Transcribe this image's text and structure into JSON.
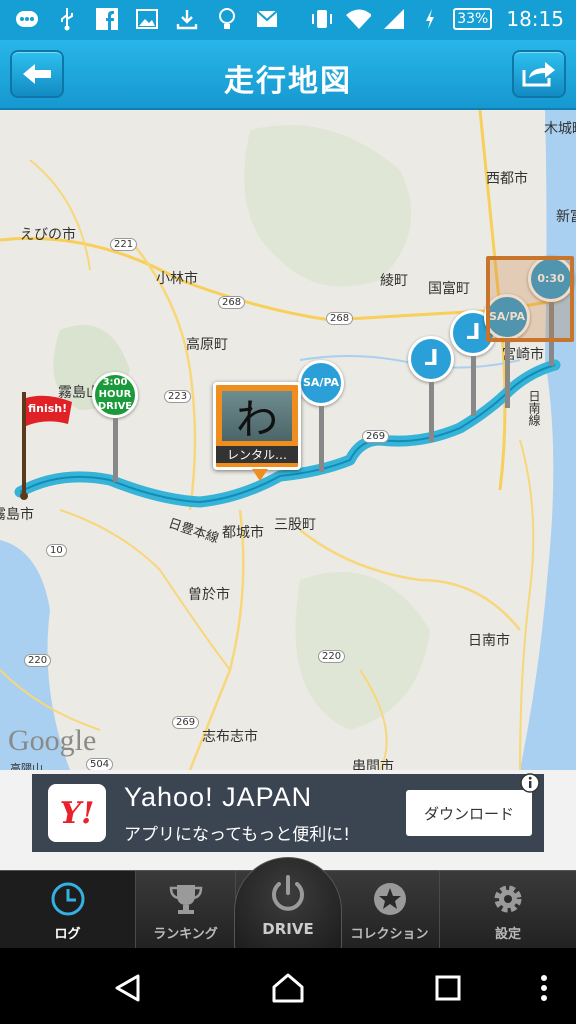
{
  "status_bar": {
    "battery": "33%",
    "time": "18:15",
    "icons": [
      "chat-icon",
      "usb-icon",
      "facebook-icon",
      "image-icon",
      "download-icon",
      "bulb-icon",
      "mail-icon",
      "vibrate-icon",
      "wifi-icon",
      "signal-icon",
      "charging-icon"
    ]
  },
  "header": {
    "title": "走行地図",
    "back_icon": "back-arrow-icon",
    "share_icon": "share-icon"
  },
  "map": {
    "labels": [
      {
        "id": "ebino",
        "text": "えびの市"
      },
      {
        "id": "kobayashi",
        "text": "小林市"
      },
      {
        "id": "takaharu",
        "text": "高原町"
      },
      {
        "id": "kirishimayama",
        "text": "霧島山"
      },
      {
        "id": "aya",
        "text": "綾町"
      },
      {
        "id": "kunitomi",
        "text": "国富町"
      },
      {
        "id": "saito",
        "text": "西都市"
      },
      {
        "id": "kijo",
        "text": "木城町"
      },
      {
        "id": "shintomi",
        "text": "新富"
      },
      {
        "id": "miyazaki",
        "text": "宮崎市"
      },
      {
        "id": "nichinan_line",
        "text": "日南線"
      },
      {
        "id": "miyakonojo",
        "text": "都城市"
      },
      {
        "id": "mimata",
        "text": "三股町"
      },
      {
        "id": "nippo_line",
        "text": "日豊本線"
      },
      {
        "id": "soo",
        "text": "曽於市"
      },
      {
        "id": "nichinan",
        "text": "日南市"
      },
      {
        "id": "shibushi",
        "text": "志布志市"
      },
      {
        "id": "kushima",
        "text": "串間市"
      },
      {
        "id": "kirishima",
        "text": "霧島市"
      },
      {
        "id": "takakuma",
        "text": "高隈山"
      },
      {
        "id": "r221",
        "text": "221"
      },
      {
        "id": "r268a",
        "text": "268"
      },
      {
        "id": "r268b",
        "text": "268"
      },
      {
        "id": "r223",
        "text": "223"
      },
      {
        "id": "r269a",
        "text": "269"
      },
      {
        "id": "r269b",
        "text": "269"
      },
      {
        "id": "r10",
        "text": "10"
      },
      {
        "id": "r220a",
        "text": "220"
      },
      {
        "id": "r220b",
        "text": "220"
      },
      {
        "id": "r504",
        "text": "504"
      }
    ],
    "google_logo": "Google",
    "finish_flag": "finish!",
    "rental_caption": "レンタル…",
    "rental_char": "わ",
    "pins": [
      {
        "id": "time-3h",
        "text": "3:00\nHOUR DRIVE",
        "color": "#1a9a3a"
      },
      {
        "id": "sapa-1",
        "text": "SA/PA",
        "color": "#2a9fd8"
      },
      {
        "id": "junction-1",
        "text": "⅃",
        "color": "#2a9fd8"
      },
      {
        "id": "junction-2",
        "text": "⅃",
        "color": "#2a9fd8"
      },
      {
        "id": "sapa-2",
        "text": "SA/PA",
        "color": "#2a9fd8"
      },
      {
        "id": "time-030",
        "text": "0:30",
        "color": "#2a9fd8"
      }
    ]
  },
  "ad": {
    "logo_text": "Y!",
    "title": "Yahoo! JAPAN",
    "subtitle": "アプリになってもっと便利に!",
    "button": "ダウンロード",
    "info_icon": "info-icon"
  },
  "tabs": [
    {
      "id": "log",
      "label": "ログ",
      "icon": "clock-icon",
      "active": true
    },
    {
      "id": "ranking",
      "label": "ランキング",
      "icon": "trophy-icon",
      "active": false
    },
    {
      "id": "drive",
      "label": "DRIVE",
      "icon": "power-icon",
      "active": false
    },
    {
      "id": "collection",
      "label": "コレクション",
      "icon": "star-icon",
      "active": false
    },
    {
      "id": "settings",
      "label": "設定",
      "icon": "gear-icon",
      "active": false
    }
  ],
  "colors": {
    "accent": "#159fd4",
    "route": "#35b6d8",
    "rental_badge": "#f08d1f"
  }
}
